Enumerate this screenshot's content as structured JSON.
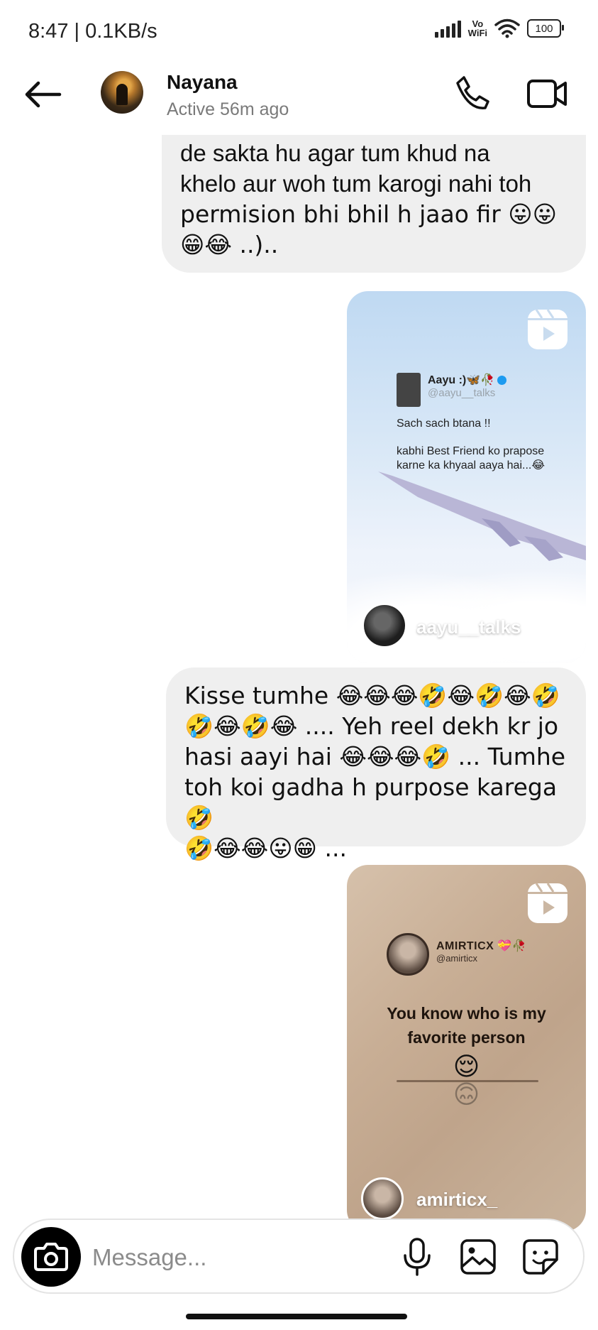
{
  "status_bar": {
    "time": "8:47 | 0.1KB/s",
    "network_label_top": "Vo",
    "network_label_bottom": "WiFi",
    "battery": "100"
  },
  "header": {
    "contact_name": "Nayana",
    "contact_status": "Active 56m ago",
    "icons": [
      "back-arrow-icon",
      "phone-icon",
      "video-call-icon"
    ]
  },
  "messages": [
    {
      "line1": "de sakta hu agar tum khud na",
      "line2": "khelo aur woh tum karogi nahi toh",
      "line3": "permision bhi bhil h jaao fir 😛😛",
      "line4": "😁😂 ..).."
    },
    {
      "reel": {
        "tweet_name": "Aayu :)🦋🥀",
        "tweet_handle": "@aayu__talks",
        "tweet_line1": "Sach sach btana !!",
        "tweet_line2": "kabhi  Best Friend  ko prapose",
        "tweet_line3": "karne ka khyaal aaya hai...😂",
        "author": "aayu__talks"
      }
    },
    {
      "line1": "Kisse tumhe 😂😂😂🤣😂🤣😂🤣",
      "line2": "🤣😂🤣😂 .... Yeh reel dekh kr jo",
      "line3": "hasi aayi hai 😂😂😂🤣 ... Tumhe",
      "line4": "toh koi gadha h purpose karega 🤣",
      "line5": "🤣😂😂😛😁 ..."
    },
    {
      "reel": {
        "post_name": "AMIRTICX 💝🥀",
        "post_handle": "@amirticx",
        "text_line1": "You know who is my",
        "text_line2": "favorite person",
        "emoji": "😌",
        "author": "amirticx_"
      }
    }
  ],
  "composer": {
    "placeholder": "Message...",
    "icons": [
      "camera-icon",
      "microphone-icon",
      "gallery-icon",
      "sticker-icon"
    ]
  },
  "colors": {
    "bubble_bg": "#efefef",
    "secondary_text": "#7a7a7a",
    "verified_blue": "#1d9bf0"
  }
}
